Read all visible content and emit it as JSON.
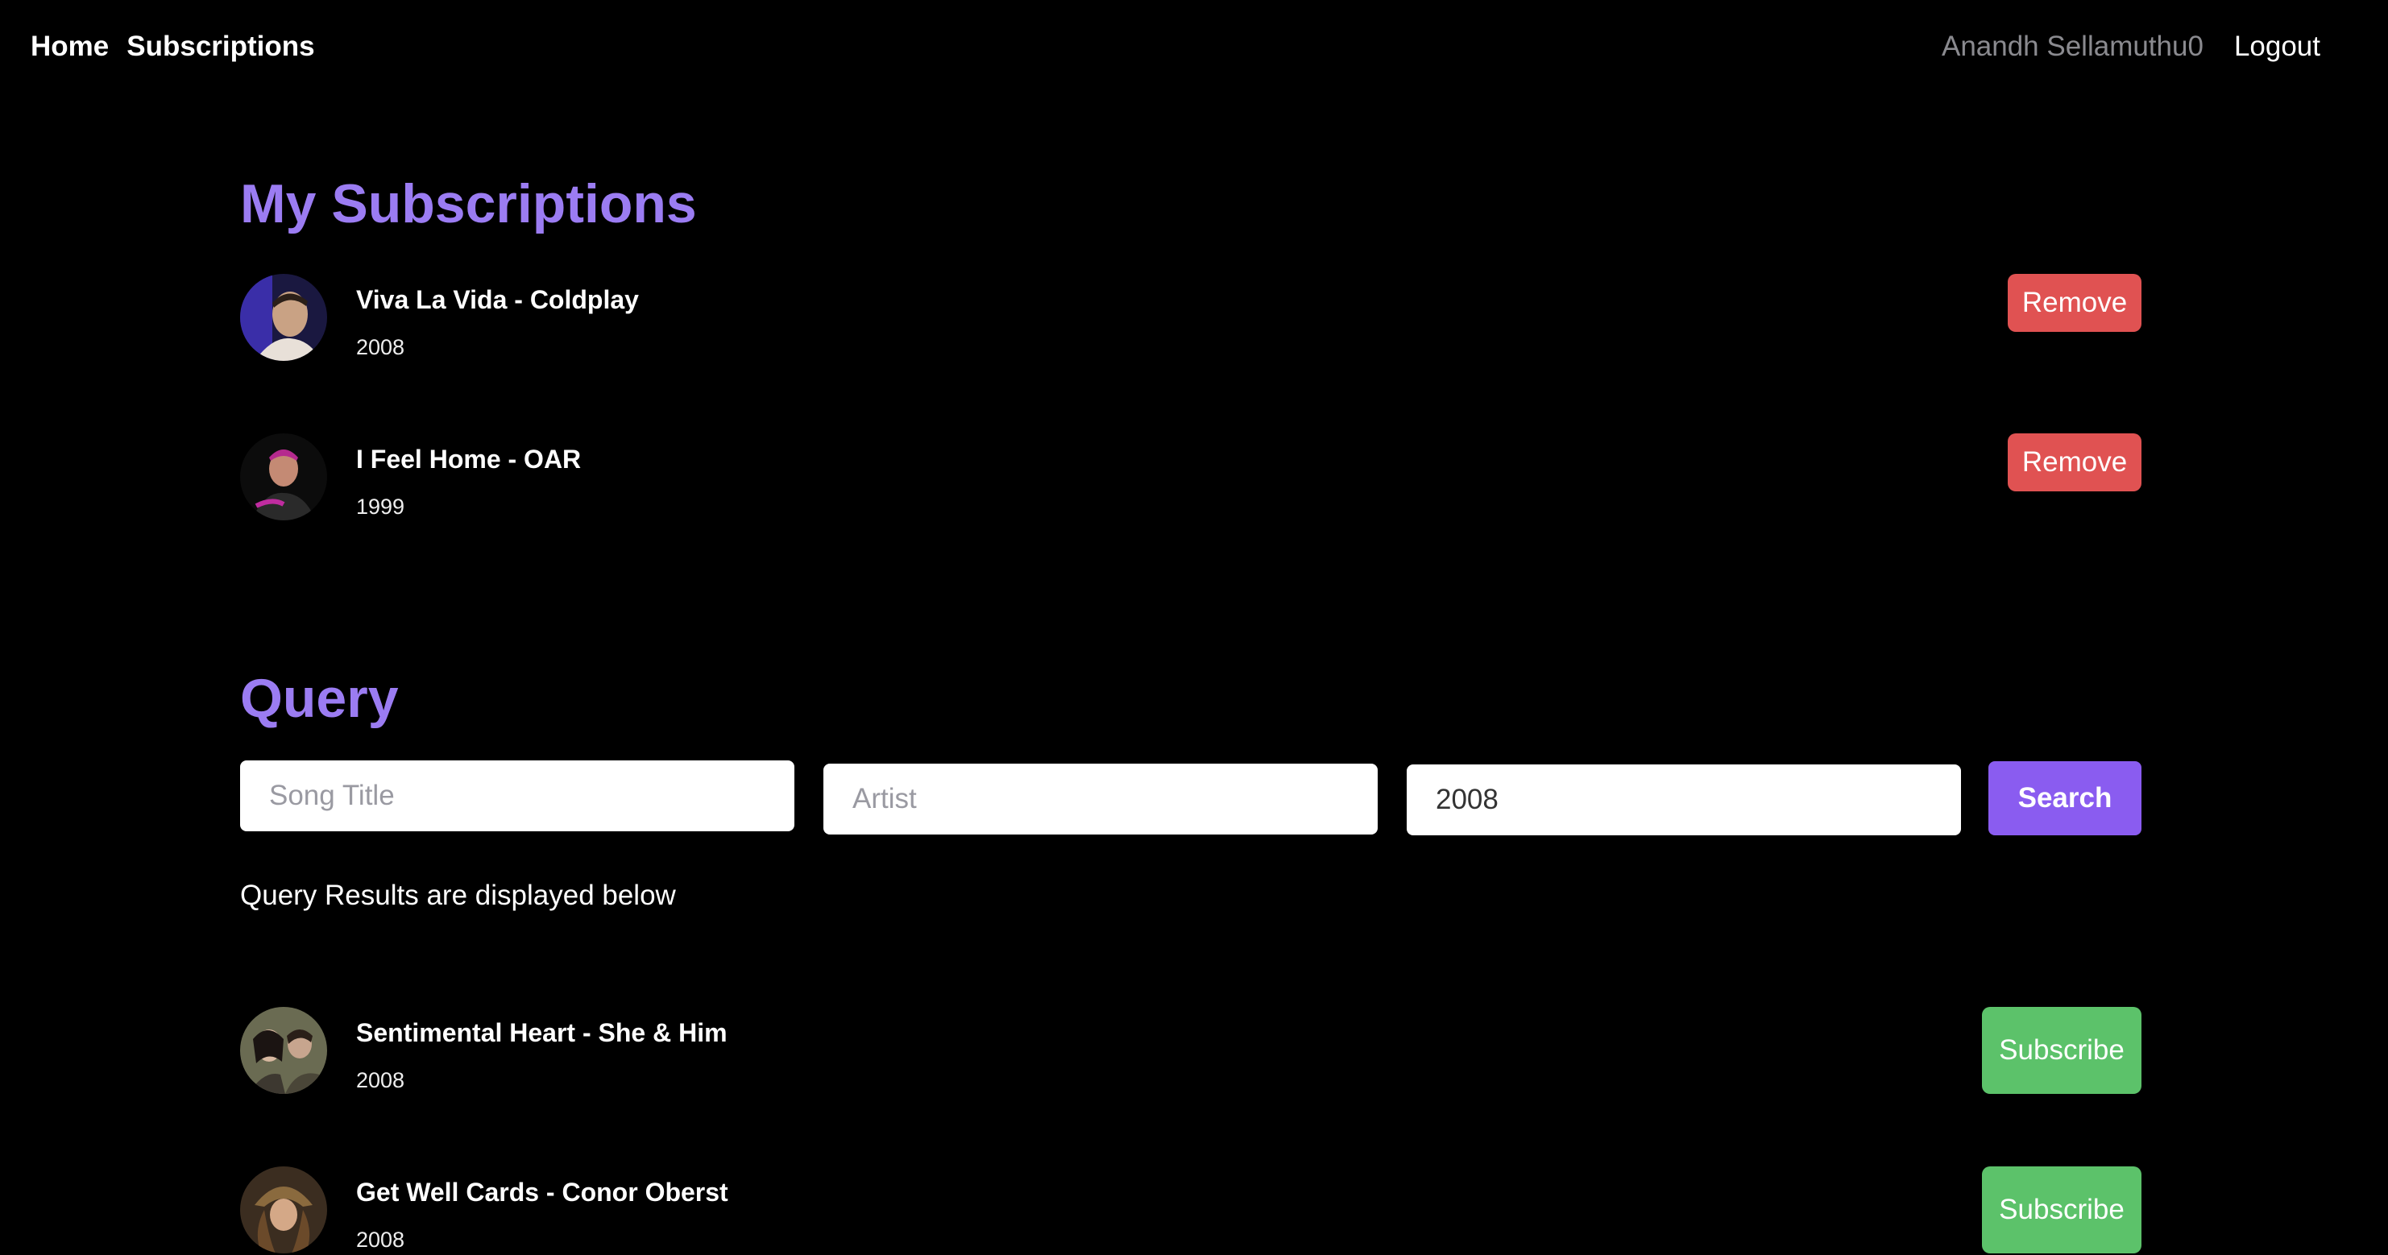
{
  "nav": {
    "home": "Home",
    "subscriptions": "Subscriptions",
    "user": "Anandh Sellamuthu0",
    "logout": "Logout"
  },
  "subscriptions": {
    "title": "My Subscriptions",
    "items": [
      {
        "title": "Viva La Vida - Coldplay",
        "year": "2008",
        "button": "Remove"
      },
      {
        "title": "I Feel Home - OAR",
        "year": "1999",
        "button": "Remove"
      }
    ]
  },
  "query": {
    "title": "Query",
    "song_title_placeholder": "Song Title",
    "artist_placeholder": "Artist",
    "year_value": "2008",
    "search_label": "Search",
    "results_note": "Query Results are displayed below",
    "results": [
      {
        "title": "Sentimental Heart - She & Him",
        "year": "2008",
        "button": "Subscribe"
      },
      {
        "title": "Get Well Cards - Conor Oberst",
        "year": "2008",
        "button": "Subscribe"
      }
    ]
  },
  "colors": {
    "heading": "#9b7cf2",
    "remove": "#e05252",
    "subscribe": "#5cc26a",
    "search": "#8a5cf0"
  }
}
